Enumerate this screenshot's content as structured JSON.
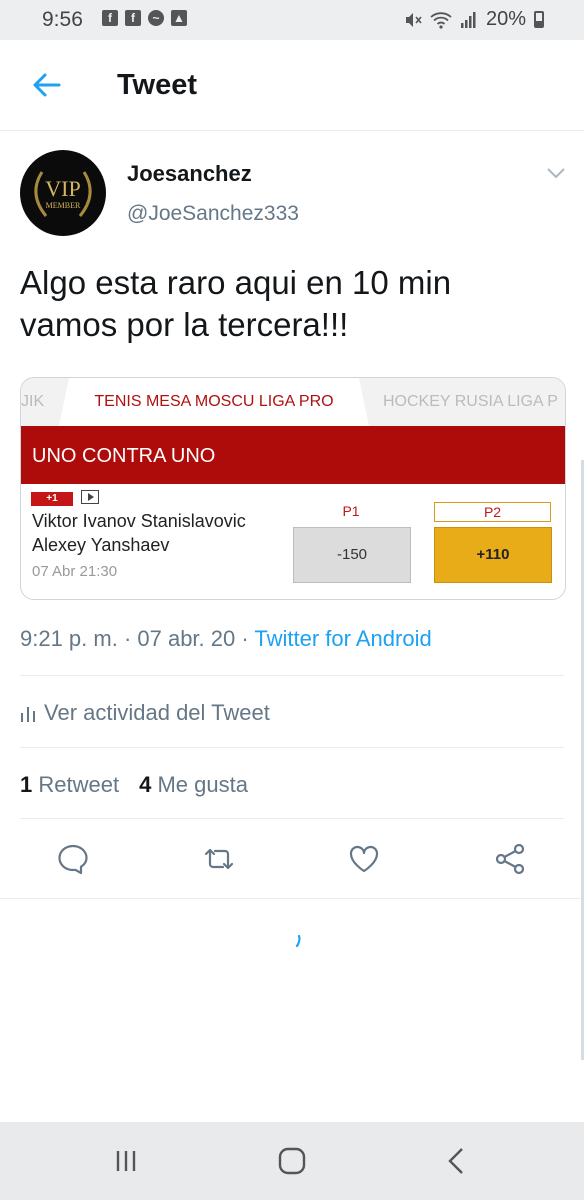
{
  "status_bar": {
    "time": "9:56",
    "notification_icons": [
      "facebook-icon",
      "facebook-icon",
      "messenger-icon",
      "gallery-icon"
    ],
    "battery": "20%",
    "system_icons": [
      "mute-icon",
      "wifi-icon",
      "signal-icon",
      "battery-icon"
    ]
  },
  "header": {
    "title": "Tweet",
    "back_icon": "arrow-left-icon"
  },
  "tweet": {
    "author_name": "Joesanchez",
    "author_handle": "@JoeSanchez333",
    "avatar_text": {
      "top": "VIP",
      "bottom": "MEMBER"
    },
    "text_lines": [
      "Algo esta raro aqui en 10 min",
      "vamos por la tercera!!!"
    ],
    "timestamp": "9:21 p. m. · 07 abr. 20 · ",
    "via": "Twitter for Android",
    "activity_label": "Ver actividad del Tweet",
    "retweets_count": "1",
    "retweets_label": "Retweet",
    "likes_count": "4",
    "likes_label": "Me gusta"
  },
  "media": {
    "tabs": [
      "JIK",
      "TENIS MESA MOSCU LIGA PRO",
      "HOCKEY RUSIA LIGA P"
    ],
    "section": "UNO CONTRA UNO",
    "live_badge": "+1",
    "players": [
      "Viktor Ivanov Stanislavovic",
      "Alexey Yanshaev"
    ],
    "match_time": "07 Abr 21:30",
    "odds": [
      {
        "label": "P1",
        "value": "-150"
      },
      {
        "label": "P2",
        "value": "+110"
      }
    ]
  },
  "actions": [
    "reply-icon",
    "retweet-icon",
    "like-icon",
    "share-icon"
  ],
  "nav": [
    "recent-apps-icon",
    "home-icon",
    "back-icon"
  ],
  "colors": {
    "accent": "#1da1f2",
    "muted": "#657786",
    "bet_red": "#ae0b0b",
    "bet_gold": "#e7ac18"
  }
}
